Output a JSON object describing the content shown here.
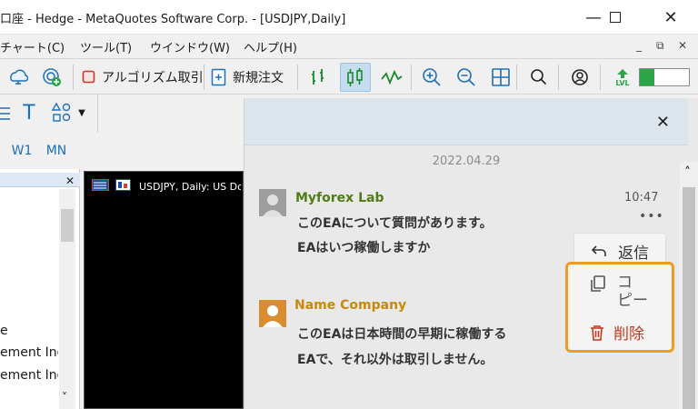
{
  "window": {
    "title": "口座 - Hedge - MetaQuotes Software Corp. - [USDJPY,Daily]",
    "minimize": "—",
    "maximize": "☐",
    "close": "✕"
  },
  "menu": {
    "items": [
      "チャート(C)",
      "ツール(T)",
      "ウインドウ(W)",
      "ヘルプ(H)"
    ],
    "mdi_min": "_",
    "mdi_restore": "⧉",
    "mdi_close": "✕"
  },
  "toolbar": {
    "algo_trading": "アルゴリズム取引",
    "new_order": "新規注文",
    "lvl": "LVL"
  },
  "timeframes": {
    "w1": "W1",
    "mn": "MN"
  },
  "tools": {
    "text_tool": "T"
  },
  "navigator": {
    "close": "✕",
    "scroll_up": "˄",
    "scroll_down": "˅",
    "lines": [
      "e",
      "ement Ind",
      "ement Ind"
    ]
  },
  "chart": {
    "label": "USDJPY, Daily:  US Dollar vs Japanese Yen"
  },
  "chat": {
    "close": "✕",
    "date": "2022.04.29",
    "scroll_up": "˄",
    "messages": [
      {
        "author": "Myforex Lab",
        "time": "10:47",
        "lines": [
          "このEAについて質問があります。",
          "EAはいつ稼働しますか"
        ],
        "dots": "•••"
      },
      {
        "author": "Name Company",
        "lines": [
          "このEAは日本時間の早期に稼働する",
          "EAで、それ以外は取引しません。"
        ]
      }
    ],
    "reply_label": "返信",
    "context_menu": {
      "copy_line1": "コ",
      "copy_line2": "ピー",
      "delete_label": "削除"
    }
  },
  "colors": {
    "author1": "#4f7d12",
    "author2": "#c98a0a",
    "highlight": "#f29b22",
    "delete": "#c23a1d"
  }
}
